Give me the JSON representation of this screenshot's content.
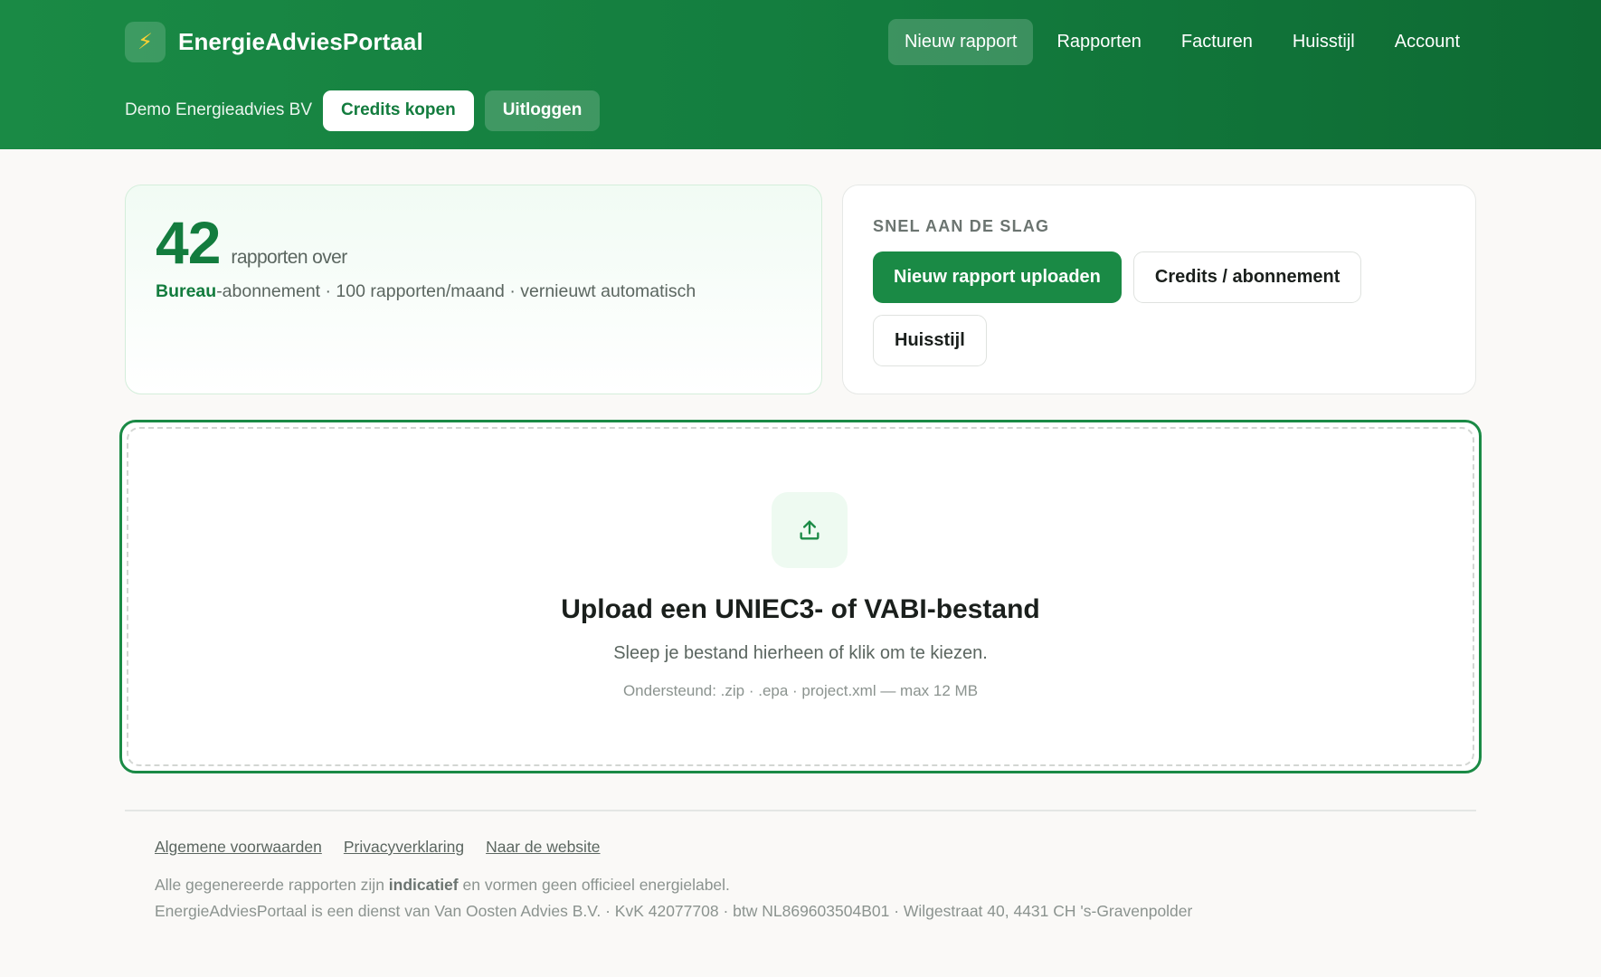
{
  "header": {
    "brand_name": "EnergieAdviesPortaal",
    "brand_icon": "lightning-bolt-icon",
    "nav": [
      {
        "label": "Nieuw rapport",
        "active": true
      },
      {
        "label": "Rapporten"
      },
      {
        "label": "Facturen"
      },
      {
        "label": "Huisstijl"
      },
      {
        "label": "Account"
      }
    ],
    "org_name": "Demo Energieadvies BV",
    "buy_credits_label": "Credits kopen",
    "logout_label": "Uitloggen"
  },
  "credits": {
    "count": "42",
    "count_label": "rapporten over",
    "plan_name": "Bureau",
    "plan_details": "-abonnement · 100 rapporten/maand · vernieuwt automatisch"
  },
  "quick": {
    "title": "SNEL AAN DE SLAG",
    "upload_label": "Nieuw rapport uploaden",
    "credits_label": "Credits / abonnement",
    "branding_label": "Huisstijl"
  },
  "dropzone": {
    "icon": "upload-icon",
    "title": "Upload een UNIEC3- of VABI-bestand",
    "subtitle": "Sleep je bestand hierheen of klik om te kiezen.",
    "hint": "Ondersteund: .zip · .epa · project.xml — max 12 MB"
  },
  "footer": {
    "links": [
      "Algemene voorwaarden",
      "Privacyverklaring",
      "Naar de website"
    ],
    "note_prefix": "Alle gegenereerde rapporten zijn ",
    "note_bold": "indicatief",
    "note_suffix": " en vormen geen officieel energielabel.",
    "legal": "EnergieAdviesPortaal is een dienst van Van Oosten Advies B.V. · KvK 42077708 · btw NL869603504B01 · Wilgestraat 40, 4431 CH 's-Gravenpolder"
  },
  "colors": {
    "brand_green": "#1a8a45",
    "brand_green_dark": "#137c3e",
    "accent_yellow": "#ffd233"
  }
}
